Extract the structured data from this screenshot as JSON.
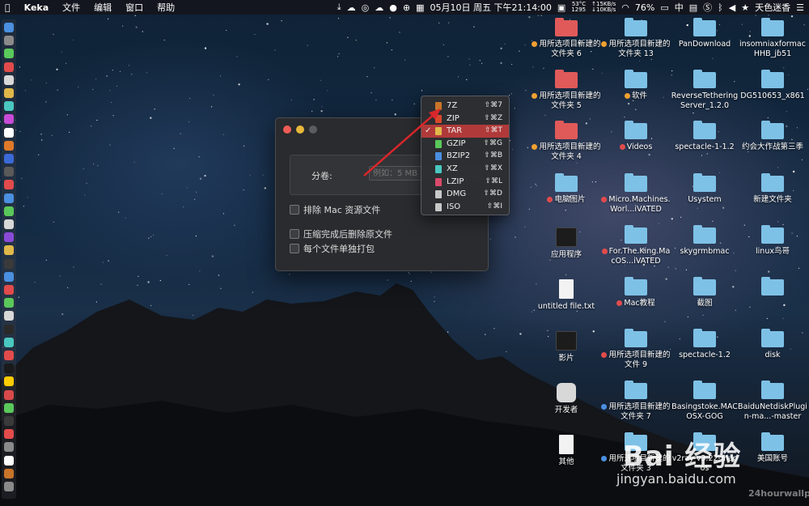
{
  "menubar": {
    "app_name": "Keka",
    "menus": [
      "文件",
      "编辑",
      "窗口",
      "帮助"
    ],
    "temp": "53°C",
    "fan": "1295",
    "net_up": "↑15KB/s",
    "net_down": "↓10KB/s",
    "datetime": "05月10日 周五 下午21:14:00",
    "battery": "76%",
    "input_method": "中",
    "username": "天色迷香"
  },
  "keka_window": {
    "volume_label": "分卷:",
    "volume_placeholder": "例如：5 MB",
    "exclude_mac_label": "排除 Mac 资源文件",
    "delete_after_label": "压缩完成后删除原文件",
    "separate_label": "每个文件单独打包"
  },
  "format_menu": {
    "items": [
      {
        "name": "7Z",
        "shortcut": "⇧⌘7",
        "color": "#c8742a"
      },
      {
        "name": "ZIP",
        "shortcut": "⇧⌘Z",
        "color": "#d9462b"
      },
      {
        "name": "TAR",
        "shortcut": "⇧⌘T",
        "color": "#e0b84a",
        "selected": true
      },
      {
        "name": "GZIP",
        "shortcut": "⇧⌘G",
        "color": "#5ac85a"
      },
      {
        "name": "BZIP2",
        "shortcut": "⇧⌘B",
        "color": "#4a8fe0"
      },
      {
        "name": "XZ",
        "shortcut": "⇧⌘X",
        "color": "#4ac8c0"
      },
      {
        "name": "LZIP",
        "shortcut": "⇧⌘L",
        "color": "#d94a6a"
      },
      {
        "name": "DMG",
        "shortcut": "⇧⌘D",
        "color": "#c8c8c8"
      },
      {
        "name": "ISO",
        "shortcut": "⇧⌘I",
        "color": "#c8c8c8"
      }
    ]
  },
  "desktop_icons": {
    "c1": [
      "用所选项目新建的文件夹 6",
      "用所选项目新建的文件夹 5",
      "用所选项目新建的文件夹 4",
      "电脑图片",
      "应用程序",
      "untitled file.txt",
      "影片",
      "开发者",
      "其他"
    ],
    "c2": [
      "用所选项目新建的文件夹 13",
      "软件",
      "Videos",
      "Micro.Machines.Worl...iVATED",
      "For.The.King.MacOS...iVATED",
      "Mac教程",
      "用所选项目新建的文件 9",
      "用所选项目新建的文件夹 7",
      "用所选项目新建的文件夹 3"
    ],
    "c3": [
      "PanDownload",
      "ReverseTetheringServer_1.2.0",
      "spectacle-1-1.2",
      "Usystem",
      "skygrmbmac",
      "截图",
      "spectacle-1.2",
      "Basingstoke.MACOSX-GOG",
      "v2ray-v3.22-macos"
    ],
    "c4": [
      "insomniaxformacHHB_jb51",
      "DG510653_x861",
      "约会大作战第三季",
      "新建文件夹",
      "linux鸟哥",
      "",
      "disk",
      "BaiduNetdiskPlugin-ma...-master",
      "美国账号"
    ]
  },
  "watermark": {
    "brand": "Bai 经验",
    "url": "jingyan.baidu.com",
    "credit": "24hourwallpa"
  }
}
